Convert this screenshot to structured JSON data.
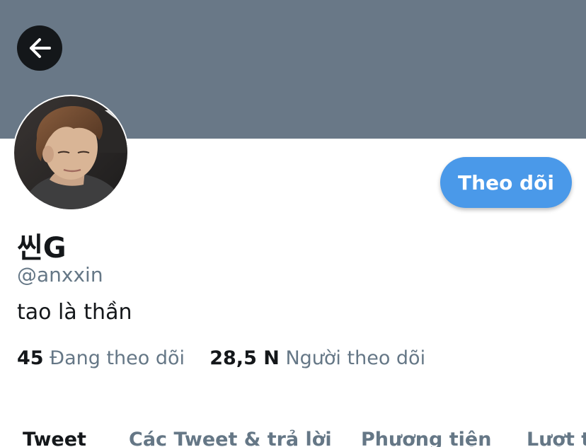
{
  "header": {
    "back_icon": "arrow-left-icon",
    "banner_color": "#697887"
  },
  "profile": {
    "display_name": "씬G",
    "handle": "@anxxin",
    "bio": "tao là thần",
    "follow_label": "Theo dõi",
    "follow_button_color": "#4a99e9",
    "avatar": "profile-photo"
  },
  "stats": {
    "following_count": "45",
    "following_label": "Đang theo dõi",
    "followers_count": "28,5 N",
    "followers_label": "Người theo dõi"
  },
  "tabs": [
    {
      "label": "Tweet",
      "active": true
    },
    {
      "label": "Các Tweet & trả lời",
      "active": false
    },
    {
      "label": "Phương tiện",
      "active": false
    },
    {
      "label": "Lượt thích",
      "active": false
    }
  ]
}
